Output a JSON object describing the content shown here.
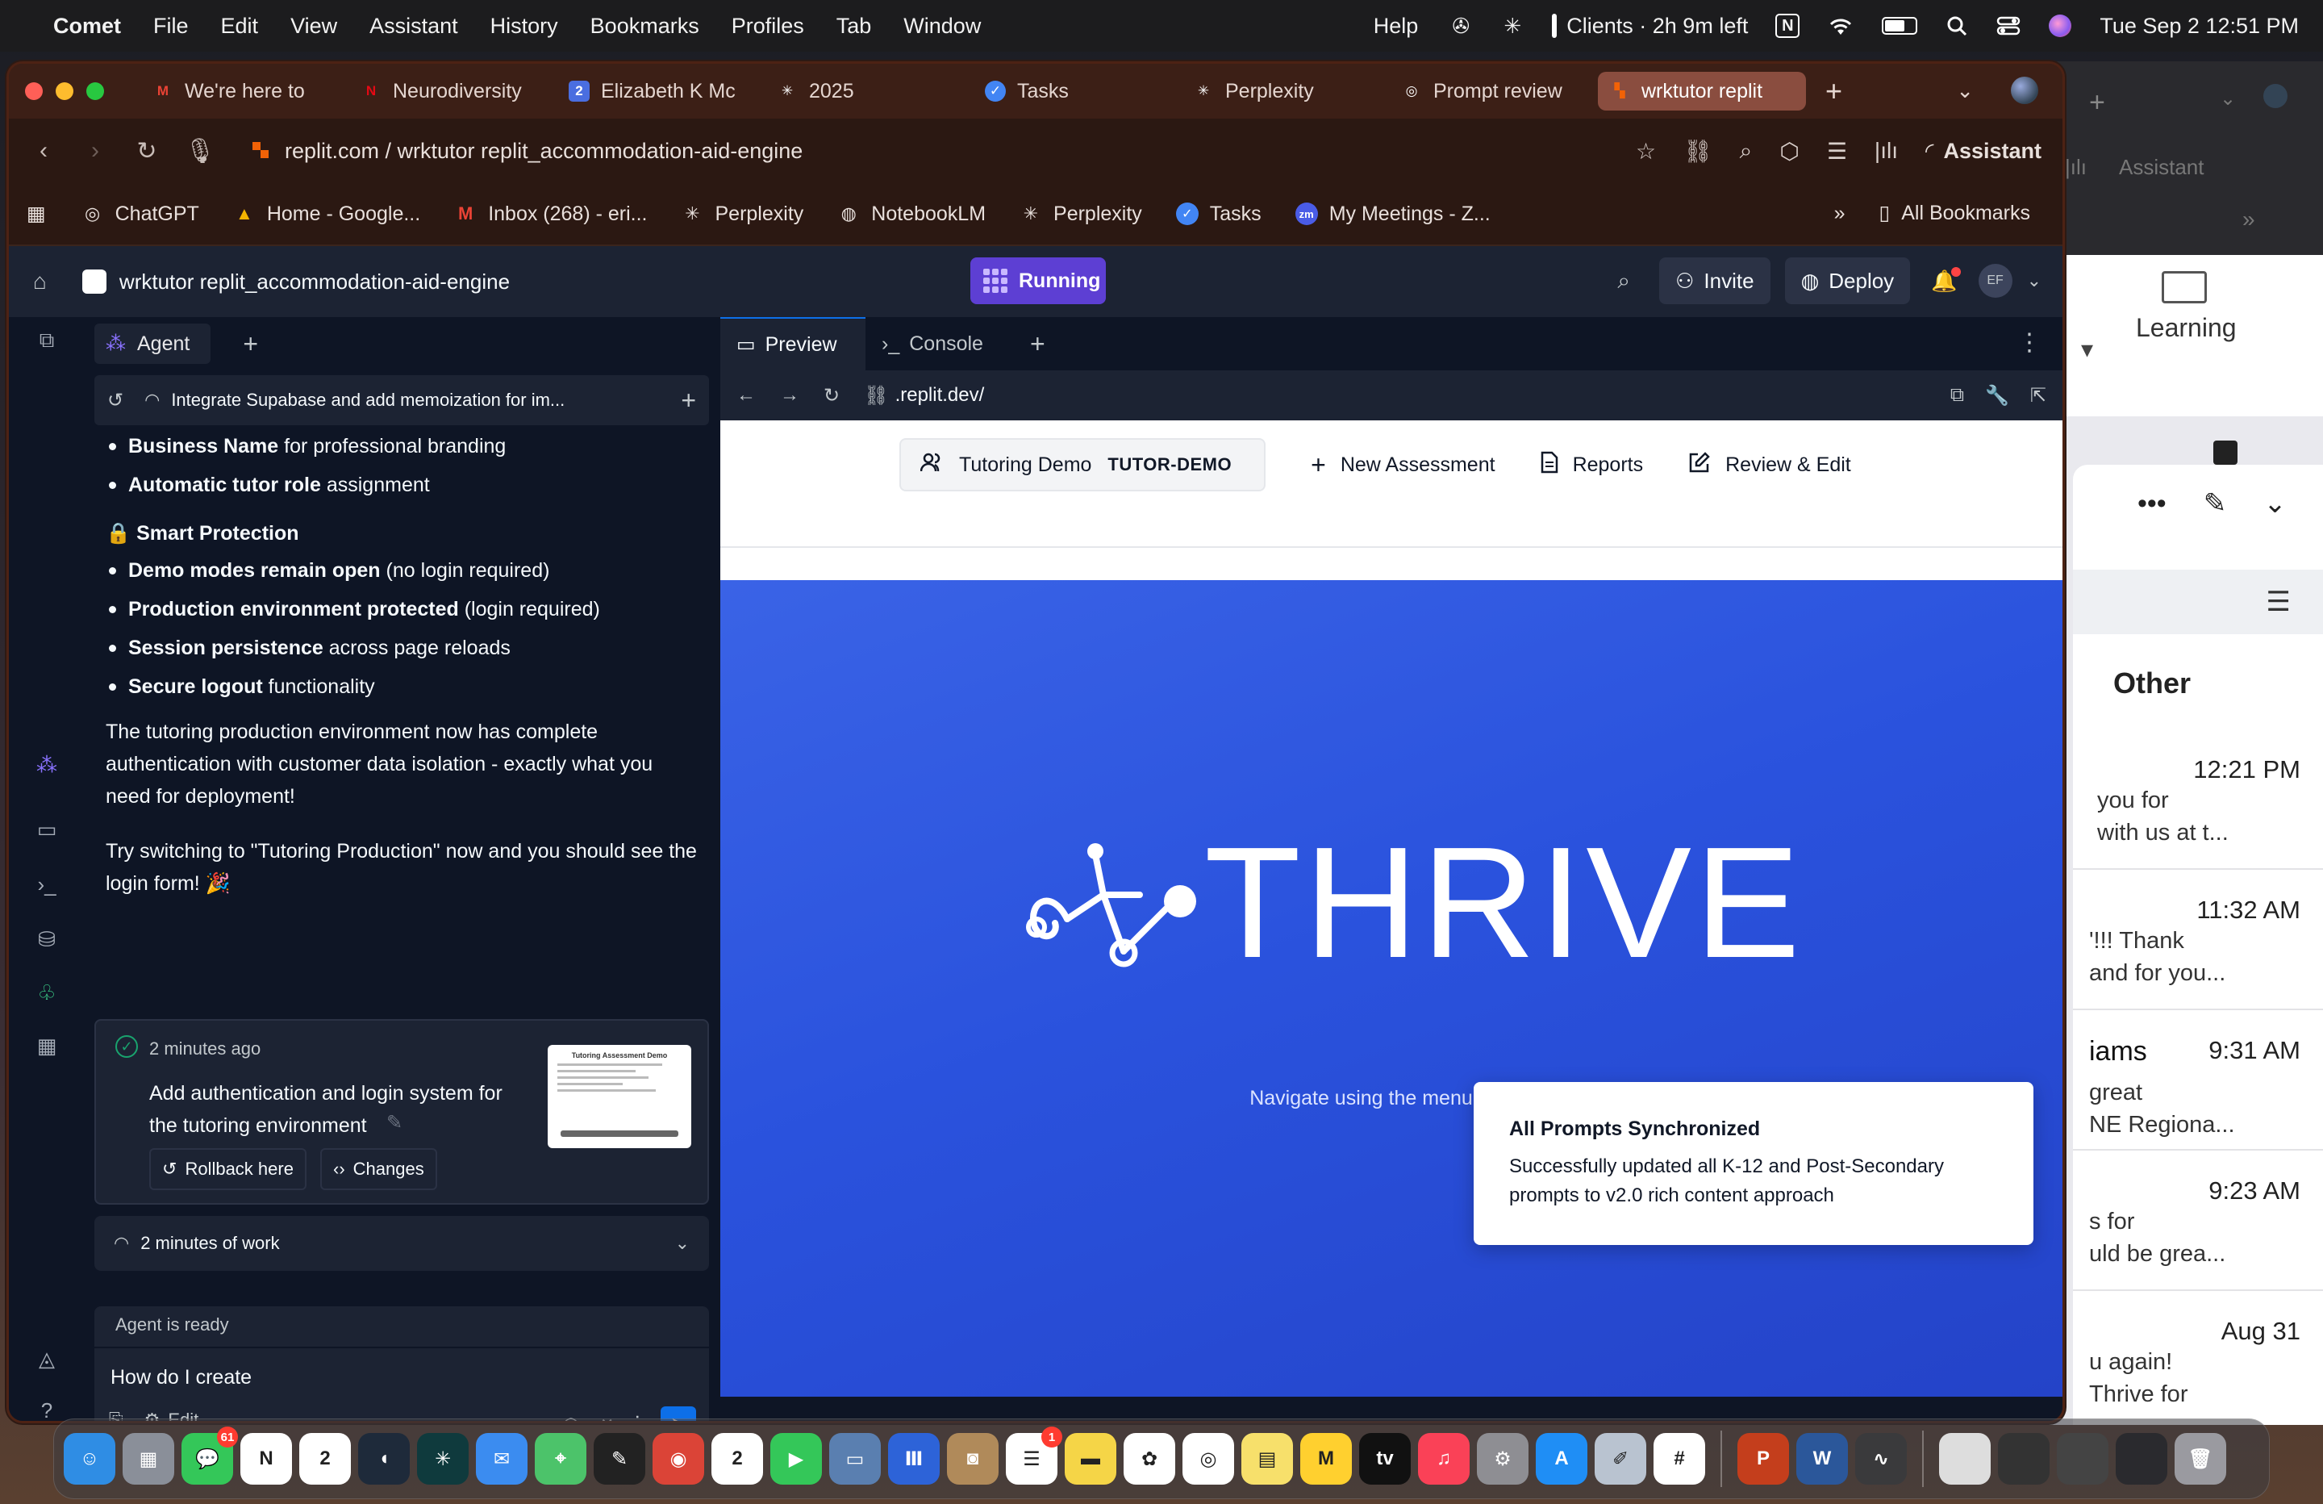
{
  "menubar": {
    "app_name": "Comet",
    "items": [
      "File",
      "Edit",
      "View",
      "Assistant",
      "History",
      "Bookmarks",
      "Profiles",
      "Tab",
      "Window"
    ],
    "help": "Help",
    "timer": "Clients · 2h 9m left",
    "notion": "N",
    "datetime": "Tue Sep 2  12:51 PM"
  },
  "tabs": [
    {
      "label": "We're here to",
      "icon": "M",
      "color": "#ea4335"
    },
    {
      "label": "Neurodiversity",
      "icon": "N",
      "color": "#e50914"
    },
    {
      "label": "Elizabeth K Mc",
      "icon": "2",
      "color": "#4a6ee0"
    },
    {
      "label": "2025",
      "icon": "✳",
      "color": "#ffffff"
    },
    {
      "label": "Tasks",
      "icon": "✓",
      "color": "#4285f4"
    },
    {
      "label": "Perplexity",
      "icon": "✳",
      "color": "#ffffff"
    },
    {
      "label": "Prompt review",
      "icon": "◎",
      "color": "#ffffff"
    },
    {
      "label": "wrktutor replit",
      "icon": "▚",
      "color": "#f26207"
    }
  ],
  "address": {
    "url": "replit.com / wrktutor replit_accommodation-aid-engine",
    "assistant_label": "Assistant"
  },
  "bookmarks": [
    {
      "label": "ChatGPT",
      "icon": "◎"
    },
    {
      "label": "Home - Google...",
      "icon": "▲"
    },
    {
      "label": "Inbox (268) - eri...",
      "icon": "M"
    },
    {
      "label": "Perplexity",
      "icon": "✳"
    },
    {
      "label": "NotebookLM",
      "icon": "◍"
    },
    {
      "label": "Perplexity",
      "icon": "✳"
    },
    {
      "label": "Tasks",
      "icon": "✓"
    },
    {
      "label": "My Meetings - Z...",
      "icon": "zm"
    }
  ],
  "bookmarks_right": {
    "more": "»",
    "all": "All Bookmarks"
  },
  "replit": {
    "project": "wrktutor replit_accommodation-aid-engine",
    "status": "Running",
    "invite": "Invite",
    "deploy": "Deploy",
    "avatar": "EF"
  },
  "agent": {
    "tab_label": "Agent",
    "thread_title": "Integrate Supabase and add memoization for im...",
    "bullets_top": [
      {
        "bold": "Business Name",
        "rest": " for professional branding"
      },
      {
        "bold": "Automatic tutor role",
        "rest": " assignment"
      }
    ],
    "section_title": "🔒 Smart Protection",
    "bullets_protection": [
      {
        "bold": "Demo modes remain open",
        "rest": " (no login required)"
      },
      {
        "bold": "Production environment protected",
        "rest": " (login required)"
      },
      {
        "bold": "Session persistence",
        "rest": " across page reloads"
      },
      {
        "bold": "Secure logout",
        "rest": " functionality"
      }
    ],
    "paragraph1": "The tutoring production environment now has complete authentication with customer data isolation - exactly what you need for deployment!",
    "paragraph2": "Try switching to \"Tutoring Production\" now and you should see the login form! 🎉",
    "checkpoint": {
      "time": "2 minutes ago",
      "title": "Add authentication and login system for the tutoring environment",
      "rollback": "Rollback here",
      "changes": "Changes",
      "thumb_title": "Tutoring Assessment Demo"
    },
    "work": "2 minutes of work",
    "input": {
      "status": "Agent is ready",
      "text": "How do I create",
      "edit": "Edit"
    }
  },
  "preview": {
    "tab_preview": "Preview",
    "tab_console": "Console",
    "url": ".replit.dev/",
    "nav": {
      "demo_label": "Tutoring Demo",
      "demo_badge": "TUTOR-DEMO",
      "new_assessment": "New Assessment",
      "reports": "Reports",
      "review_edit": "Review & Edit"
    },
    "brand": "THRIVE",
    "subtitle": "Navigate using the menu above",
    "toast": {
      "title": "All Prompts Synchronized",
      "body": "Successfully updated all K-12 and Post-Secondary prompts to v2.0 rich content approach"
    }
  },
  "bg_email": {
    "learning": "Learning",
    "other": "Other",
    "rows": [
      {
        "time": "12:21 PM",
        "name": "",
        "snippet": "you for\nwith us at t..."
      },
      {
        "time": "11:32 AM",
        "name": "",
        "snippet": "'!!! Thank\nand for you..."
      },
      {
        "time": "9:31 AM",
        "name": "iams",
        "snippet": "great\nNE Regiona..."
      },
      {
        "time": "9:23 AM",
        "name": "",
        "snippet": "s for\nuld be grea..."
      },
      {
        "time": "Aug 31",
        "name": "",
        "snippet": "u again!\nThrive for"
      }
    ]
  },
  "dock": {
    "apps": [
      {
        "name": "finder",
        "color": "#2f8de4",
        "glyph": "☺"
      },
      {
        "name": "launchpad",
        "color": "#8a8f99",
        "glyph": "▦"
      },
      {
        "name": "messages",
        "color": "#34c759",
        "glyph": "💬",
        "badge": "61"
      },
      {
        "name": "notion",
        "color": "#ffffff",
        "glyph": "N"
      },
      {
        "name": "calendar-2",
        "color": "#ffffff",
        "glyph": "2"
      },
      {
        "name": "comet",
        "color": "#1e2a3a",
        "glyph": "◖"
      },
      {
        "name": "perplexity",
        "color": "#0f3a3d",
        "glyph": "✳"
      },
      {
        "name": "mail",
        "color": "#3b8cf0",
        "glyph": "✉"
      },
      {
        "name": "maps",
        "color": "#4cc36a",
        "glyph": "⌖"
      },
      {
        "name": "script",
        "color": "#222222",
        "glyph": "✎"
      },
      {
        "name": "chrome",
        "color": "#db4437",
        "glyph": "◉"
      },
      {
        "name": "calendar",
        "color": "#ffffff",
        "glyph": "2"
      },
      {
        "name": "facetime",
        "color": "#34c759",
        "glyph": "▶"
      },
      {
        "name": "preview",
        "color": "#5a7fb0",
        "glyph": "▭"
      },
      {
        "name": "otter",
        "color": "#2d63d8",
        "glyph": "Ⅲ"
      },
      {
        "name": "contacts",
        "color": "#b08a5a",
        "glyph": "◙"
      },
      {
        "name": "reminders",
        "color": "#ffffff",
        "glyph": "☰",
        "badge": "1"
      },
      {
        "name": "notes",
        "color": "#f5d547",
        "glyph": "▬"
      },
      {
        "name": "photos",
        "color": "#ffffff",
        "glyph": "✿"
      },
      {
        "name": "chatgpt",
        "color": "#ffffff",
        "glyph": "◎"
      },
      {
        "name": "stickies",
        "color": "#f7e06b",
        "glyph": "▤"
      },
      {
        "name": "miro",
        "color": "#ffd02f",
        "glyph": "M"
      },
      {
        "name": "apple-tv",
        "color": "#111111",
        "glyph": "tv"
      },
      {
        "name": "music",
        "color": "#fa4157",
        "glyph": "♫"
      },
      {
        "name": "settings",
        "color": "#8e8e93",
        "glyph": "⚙"
      },
      {
        "name": "app-store",
        "color": "#1f8ef5",
        "glyph": "A"
      },
      {
        "name": "pencil",
        "color": "#b9c3d0",
        "glyph": "✐"
      },
      {
        "name": "slack",
        "color": "#ffffff",
        "glyph": "#"
      },
      {
        "name": "powerpoint",
        "color": "#c43e1c",
        "glyph": "P"
      },
      {
        "name": "word",
        "color": "#2b579a",
        "glyph": "W"
      },
      {
        "name": "audio",
        "color": "#3a3a3c",
        "glyph": "∿"
      },
      {
        "name": "window-1",
        "color": "#dddddd",
        "glyph": ""
      },
      {
        "name": "window-2",
        "color": "#333333",
        "glyph": ""
      },
      {
        "name": "window-3",
        "color": "#444444",
        "glyph": ""
      },
      {
        "name": "window-4",
        "color": "#2a2a2e",
        "glyph": ""
      },
      {
        "name": "trash",
        "color": "#9a9aa0",
        "glyph": "🗑"
      }
    ]
  }
}
